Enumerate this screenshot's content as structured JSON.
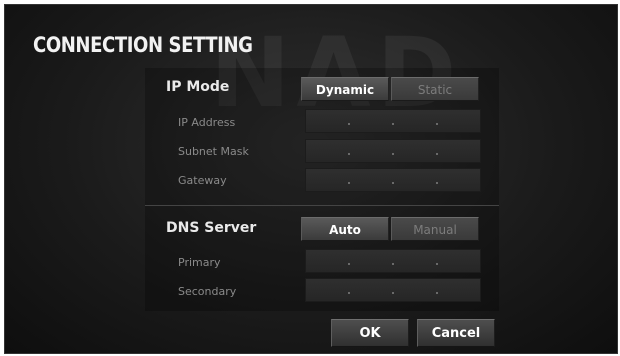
{
  "title": "CONNECTION SETTING",
  "watermark": "NAD",
  "ip_mode": {
    "label": "IP Mode",
    "options": [
      "Dynamic",
      "Static"
    ],
    "selected": "Dynamic",
    "fields": [
      {
        "label": "IP Address"
      },
      {
        "label": "Subnet Mask"
      },
      {
        "label": "Gateway"
      }
    ]
  },
  "dns": {
    "label": "DNS Server",
    "options": [
      "Auto",
      "Manual"
    ],
    "selected": "Auto",
    "fields": [
      {
        "label": "Primary"
      },
      {
        "label": "Secondary"
      }
    ]
  },
  "footer": {
    "ok_label": "OK",
    "cancel_label": "Cancel"
  }
}
